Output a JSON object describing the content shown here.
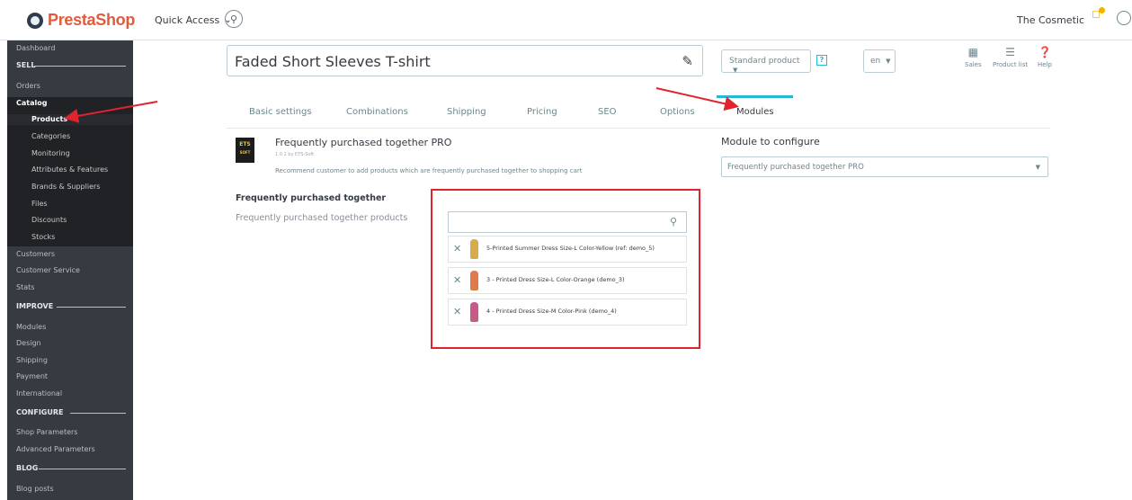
{
  "topbar": {
    "logo_text": "PrestaShop",
    "quick_access": "Quick Access",
    "shop_name": "The Cosmetic"
  },
  "sidebar": {
    "dashboard": "Dashboard",
    "sell_header": "SELL",
    "orders": "Orders",
    "catalog": "Catalog",
    "catalog_items": [
      "Products",
      "Categories",
      "Monitoring",
      "Attributes & Features",
      "Brands & Suppliers",
      "Files",
      "Discounts",
      "Stocks"
    ],
    "customers": "Customers",
    "customer_service": "Customer Service",
    "stats": "Stats",
    "improve_header": "IMPROVE",
    "improve_items": [
      "Modules",
      "Design",
      "Shipping",
      "Payment",
      "International"
    ],
    "configure_header": "CONFIGURE",
    "configure_items": [
      "Shop Parameters",
      "Advanced Parameters"
    ],
    "blog_header": "BLOG",
    "blog_items": [
      "Blog posts"
    ]
  },
  "product": {
    "title": "Faded Short Sleeves T-shirt",
    "type": "Standard product",
    "type_help": "?",
    "language": "en"
  },
  "toolbar": {
    "sales": "Sales",
    "product_list": "Product list",
    "help": "Help"
  },
  "tabs": [
    "Basic settings",
    "Combinations",
    "Shipping",
    "Pricing",
    "SEO",
    "Options",
    "Modules"
  ],
  "module": {
    "logo_line1": "ETS",
    "logo_line2": "SOFT",
    "name": "Frequently purchased together PRO",
    "version": "1.0.1 by ETS-Soft",
    "description": "Recommend customer to add products which are frequently purchased together to shopping cart",
    "section_title": "Frequently purchased together",
    "field_label": "Frequently purchased together products",
    "search_placeholder": "",
    "products": [
      {
        "name": "5-Printed Summer Dress Size-L Color-Yellow (ref: demo_5)",
        "color": "#d9a94a"
      },
      {
        "name": "3 - Printed Dress Size-L Color-Orange (demo_3)",
        "color": "#e07a4a"
      },
      {
        "name": "4 - Printed Dress Size-M Color-Pink (demo_4)",
        "color": "#c85a8a"
      }
    ]
  },
  "config": {
    "title": "Module to configure",
    "selected": "Frequently purchased together PRO"
  },
  "colors": {
    "accent": "#25b9d7",
    "sidebar_bg": "#363a41",
    "annotation_red": "#e0232c"
  }
}
